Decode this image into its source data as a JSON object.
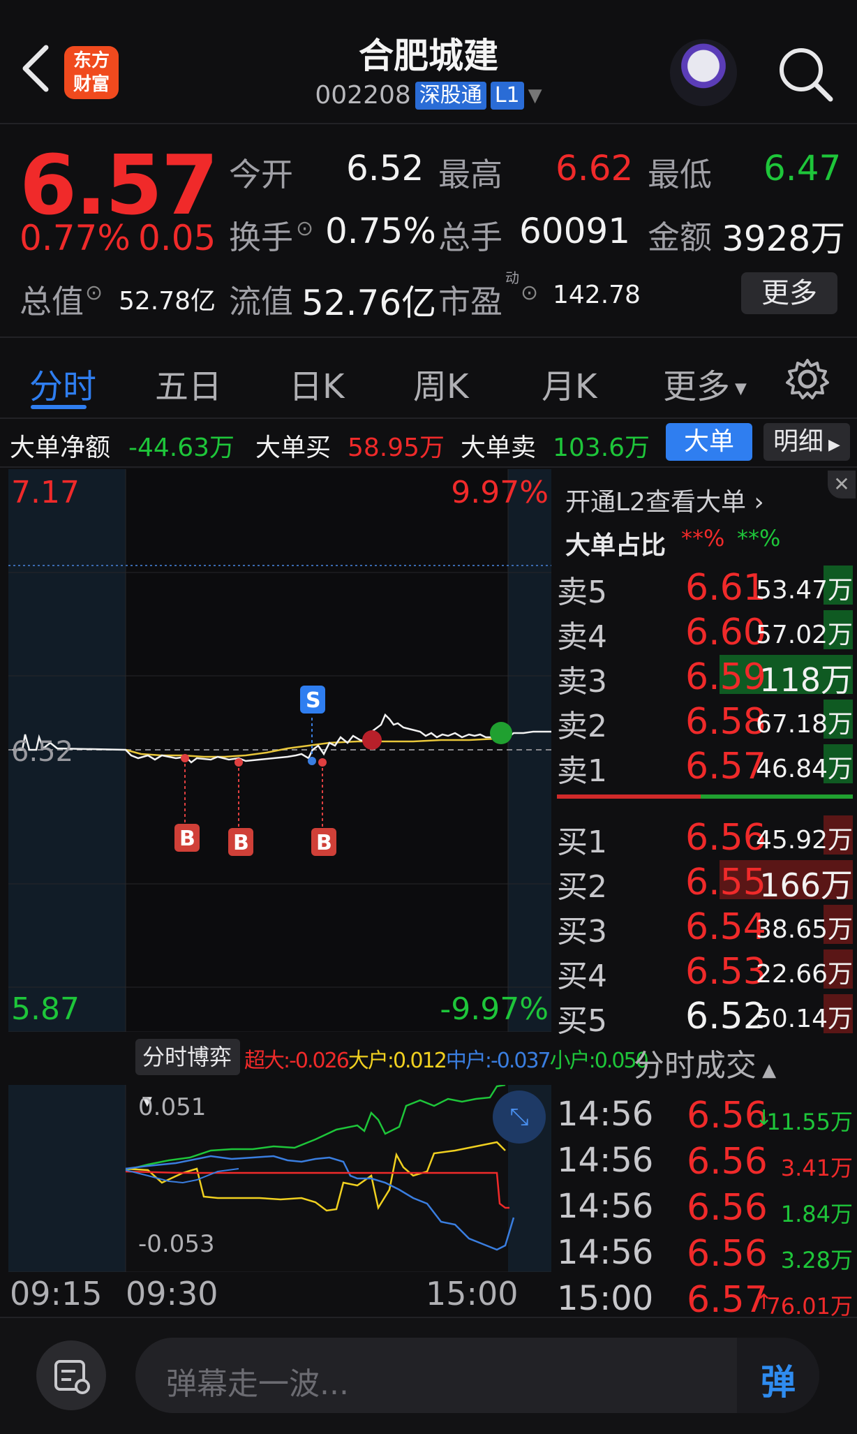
{
  "header": {
    "logo_line1": "东方",
    "logo_line2": "财富",
    "title": "合肥城建",
    "code": "002208",
    "tag1": "深股通",
    "tag2": "L1"
  },
  "quote": {
    "price": "6.57",
    "change_pct": "0.77%",
    "change": "0.05",
    "open_label": "今开",
    "open": "6.52",
    "high_label": "最高",
    "high": "6.62",
    "low_label": "最低",
    "low": "6.47",
    "turnover_label": "换手",
    "turnover": "0.75%",
    "volume_label": "总手",
    "volume": "60091",
    "amount_label": "金额",
    "amount": "3928万",
    "total_mv_label": "总值",
    "total_mv": "52.78亿",
    "float_mv_label": "流值",
    "float_mv": "52.76亿",
    "pe_label": "市盈",
    "pe_sup": "动",
    "pe": "142.78",
    "more_button": "更多"
  },
  "tabs": [
    "分时",
    "五日",
    "日K",
    "周K",
    "月K",
    "更多"
  ],
  "big_order": {
    "net_label": "大单净额",
    "net": "-44.63万",
    "buy_label": "大单买",
    "buy": "58.95万",
    "sell_label": "大单卖",
    "sell": "103.6万",
    "btn_big": "大单",
    "btn_detail": "明细"
  },
  "chart": {
    "top_price": "7.17",
    "top_pct": "9.97%",
    "bottom_price": "5.87",
    "bottom_pct": "-9.97%",
    "ref_price": "6.52",
    "marker_s": "S",
    "marker_b": "B"
  },
  "orderbook": {
    "l2_link": "开通L2查看大单",
    "ratio_label": "大单占比",
    "ratio_red": "**%",
    "ratio_green": "**%",
    "asks": [
      {
        "label": "卖5",
        "price": "6.61",
        "vol": "53.47万",
        "bar": 0.1
      },
      {
        "label": "卖4",
        "price": "6.60",
        "vol": "57.02万",
        "bar": 0.1
      },
      {
        "label": "卖3",
        "price": "6.59",
        "vol": "118万",
        "bar": 0.45
      },
      {
        "label": "卖2",
        "price": "6.58",
        "vol": "67.18万",
        "bar": 0.1
      },
      {
        "label": "卖1",
        "price": "6.57",
        "vol": "46.84万",
        "bar": 0.1
      }
    ],
    "bids": [
      {
        "label": "买1",
        "price": "6.56",
        "vol": "45.92万",
        "bar": 0.1
      },
      {
        "label": "买2",
        "price": "6.55",
        "vol": "166万",
        "bar": 0.45
      },
      {
        "label": "买3",
        "price": "6.54",
        "vol": "38.65万",
        "bar": 0.1
      },
      {
        "label": "买4",
        "price": "6.53",
        "vol": "22.66万",
        "bar": 0.1
      },
      {
        "label": "买5",
        "price": "6.52",
        "vol": "50.14万",
        "bar": 0.1
      }
    ]
  },
  "game": {
    "dropdown": "分时博弈",
    "super_label": "超大:",
    "super": "-0.026",
    "large_label": "大户:",
    "large": "0.012",
    "mid_label": "中户:",
    "mid": "-0.037",
    "small_label": "小户:",
    "small": "0.050",
    "max": "0.051",
    "min": "-0.053"
  },
  "time_axis": [
    "09:15",
    "09:30",
    "15:00"
  ],
  "trades": {
    "title": "分时成交",
    "rows": [
      {
        "time": "14:56",
        "price": "6.56",
        "vol": "11.55万",
        "dir": "↓",
        "color": "green"
      },
      {
        "time": "14:56",
        "price": "6.56",
        "vol": "3.41万",
        "dir": "",
        "color": "red"
      },
      {
        "time": "14:56",
        "price": "6.56",
        "vol": "1.84万",
        "dir": "",
        "color": "green"
      },
      {
        "time": "14:56",
        "price": "6.56",
        "vol": "3.28万",
        "dir": "",
        "color": "green"
      },
      {
        "time": "15:00",
        "price": "6.57",
        "vol": "76.01万",
        "dir": "↑",
        "color": "red"
      }
    ]
  },
  "footer": {
    "placeholder": "弹幕走一波...",
    "send": "弹"
  },
  "colors": {
    "up": "#f02a2a",
    "down": "#1ec63a",
    "accent": "#2f7ef0"
  }
}
